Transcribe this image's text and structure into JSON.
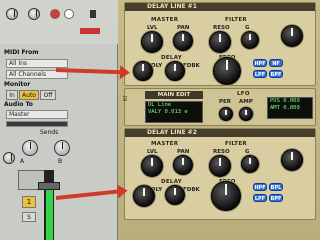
{
  "mixer": {
    "midi_from_label": "MIDI From",
    "midi_from_value": "All Ins",
    "midi_channel_value": "All Channels",
    "monitor_label": "Monitor",
    "monitor_in": "In",
    "monitor_auto": "Auto",
    "monitor_off": "Off",
    "audio_to_label": "Audio To",
    "audio_to_value": "Master",
    "sends_label": "Sends",
    "send_a": "A",
    "send_b": "B",
    "track_number": "1",
    "solo": "S",
    "meter_level": 0.8
  },
  "plugin": {
    "delay_line_1": "DELAY LINE #1",
    "delay_line_2": "DELAY LINE #2",
    "master": "MASTER",
    "delay": "DELAY",
    "filter": "FILTER",
    "freq": "FREQ",
    "lvl": "LVL",
    "pan": "PAN",
    "reso": "RESO",
    "g": "G",
    "dly": "DLY",
    "fdbk": "FDBK",
    "hpf": "HPF",
    "bpf": "BPF",
    "lpf": "LPF",
    "bpl": "BPL",
    "nf": "NF",
    "main_edit": "MAIN EDIT",
    "lcd_line1": "DL Line",
    "lcd_line2": "VALY  0.013  e",
    "lfo": "LFO",
    "per": "PER",
    "amp": "AMP",
    "pos": "POS",
    "pos_val": "0.000",
    "amt": "AMT",
    "amt_val": "0.000"
  },
  "colors": {
    "accent_arrow": "#d13a2a",
    "filter_button": "#2f6fd6",
    "panel": "#d9cea1"
  }
}
